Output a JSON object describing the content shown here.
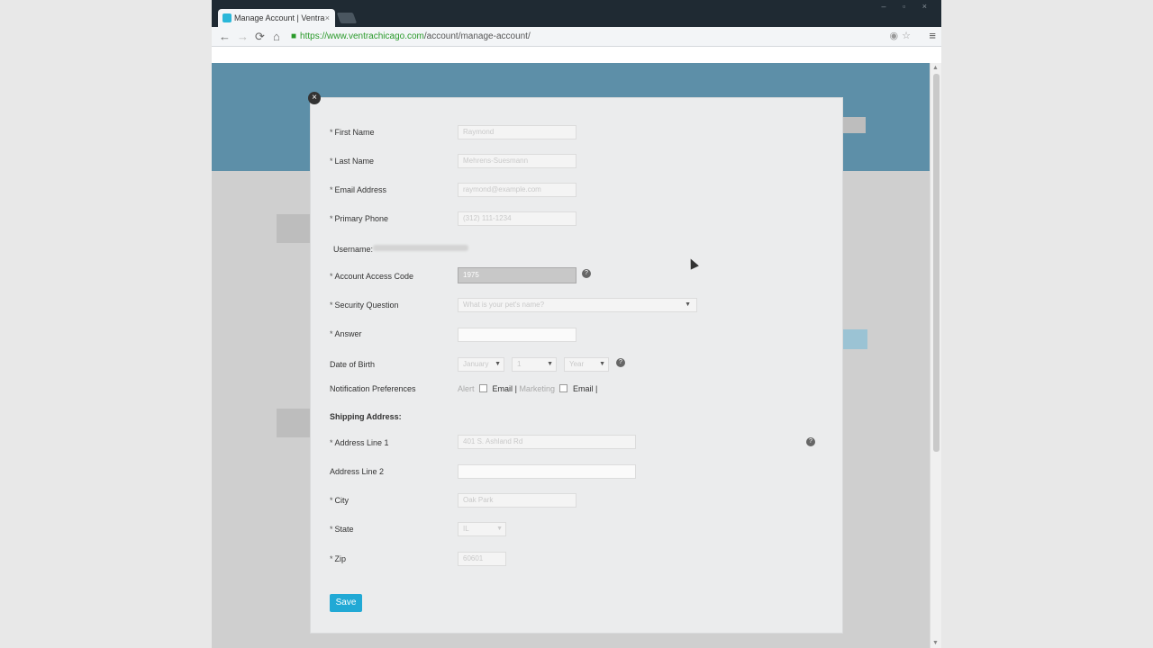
{
  "browser": {
    "tab_title": "Manage Account | Ventra",
    "tab_close": "×",
    "url_host": "https://www.ventrachicago.com",
    "url_path": "/account/manage-account/",
    "back": "←",
    "forward": "→",
    "reload": "⟳",
    "home": "⌂",
    "menu": "≡",
    "window_controls": "– ▫ ×"
  },
  "modal": {
    "close": "×",
    "labels": {
      "first_name": "First Name",
      "last_name": "Last Name",
      "email": "Email Address",
      "phone": "Primary Phone",
      "username": "Username:",
      "access_code": "Account Access Code",
      "security_question": "Security Question",
      "answer": "Answer",
      "dob": "Date of Birth",
      "notifications": "Notification Preferences",
      "shipping": "Shipping Address:",
      "address1": "Address Line 1",
      "address2": "Address Line 2",
      "city": "City",
      "state": "State",
      "zip": "Zip"
    },
    "required_mark": "*",
    "values": {
      "first_name": "Raymond",
      "last_name": "Mehrens-Suesmann",
      "email": "raymond@example.com",
      "phone": "(312) 111-1234",
      "access_code": "1975",
      "security_question": "What is your pet's name?",
      "answer": "",
      "dob_month": "January",
      "dob_day": "1",
      "dob_year": "Year",
      "address1": "401 S. Ashland Rd",
      "address2": "",
      "city": "Oak Park",
      "state": "IL",
      "zip": "60601"
    },
    "notifications": {
      "alert_label": "Alert",
      "alert_email": "Email",
      "marketing_label": "Marketing",
      "marketing_email": "Email",
      "separator": "|"
    },
    "help": "?",
    "save": "Save"
  },
  "colors": {
    "save_button": "#21a9d5",
    "header_bg": "#5d8fa8"
  }
}
